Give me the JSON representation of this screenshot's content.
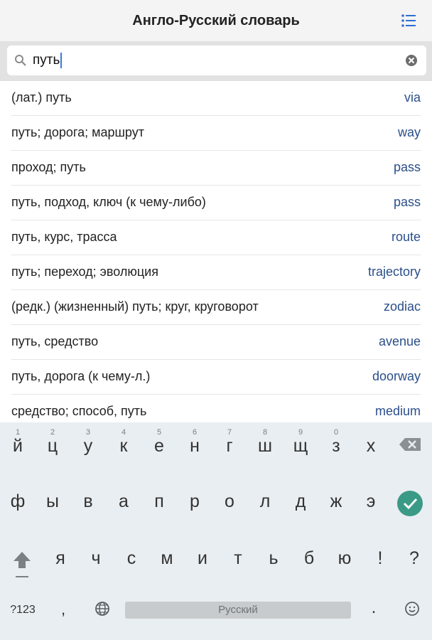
{
  "app": {
    "title": "Англо-Русский словарь"
  },
  "search": {
    "value": "путь"
  },
  "results": [
    {
      "ru": "(лат.) путь",
      "en": "via"
    },
    {
      "ru": "путь; дорога; маршрут",
      "en": "way"
    },
    {
      "ru": "проход; путь",
      "en": "pass"
    },
    {
      "ru": "путь, подход, ключ (к чему-либо)",
      "en": "pass"
    },
    {
      "ru": "путь, курс, трасса",
      "en": "route"
    },
    {
      "ru": "путь; переход; эволюция",
      "en": "trajectory"
    },
    {
      "ru": "(редк.) (жизненный) путь; круг, круговорот",
      "en": "zodiac"
    },
    {
      "ru": "путь, средство",
      "en": "avenue"
    },
    {
      "ru": "путь, дорога (к чему-л.)",
      "en": "doorway"
    },
    {
      "ru": "средство; способ, путь",
      "en": "medium"
    }
  ],
  "keyboard": {
    "row1": [
      "й",
      "ц",
      "у",
      "к",
      "е",
      "н",
      "г",
      "ш",
      "щ",
      "з",
      "х"
    ],
    "row1_hints": [
      "1",
      "2",
      "3",
      "4",
      "5",
      "6",
      "7",
      "8",
      "9",
      "0",
      ""
    ],
    "row2": [
      "ф",
      "ы",
      "в",
      "а",
      "п",
      "р",
      "о",
      "л",
      "д",
      "ж",
      "э"
    ],
    "row3": [
      "я",
      "ч",
      "с",
      "м",
      "и",
      "т",
      "ь",
      "б",
      "ю",
      "!",
      "?"
    ],
    "symbols_label": "?123",
    "comma": ",",
    "space_label": "Русский",
    "period": ".",
    "accent_color": "#3a9a86",
    "icons": [
      "backspace-icon",
      "done-check-icon",
      "shift-icon",
      "globe-icon",
      "emoji-icon"
    ]
  },
  "colors": {
    "link": "#2b4f8a",
    "caret": "#3a7bd5"
  }
}
